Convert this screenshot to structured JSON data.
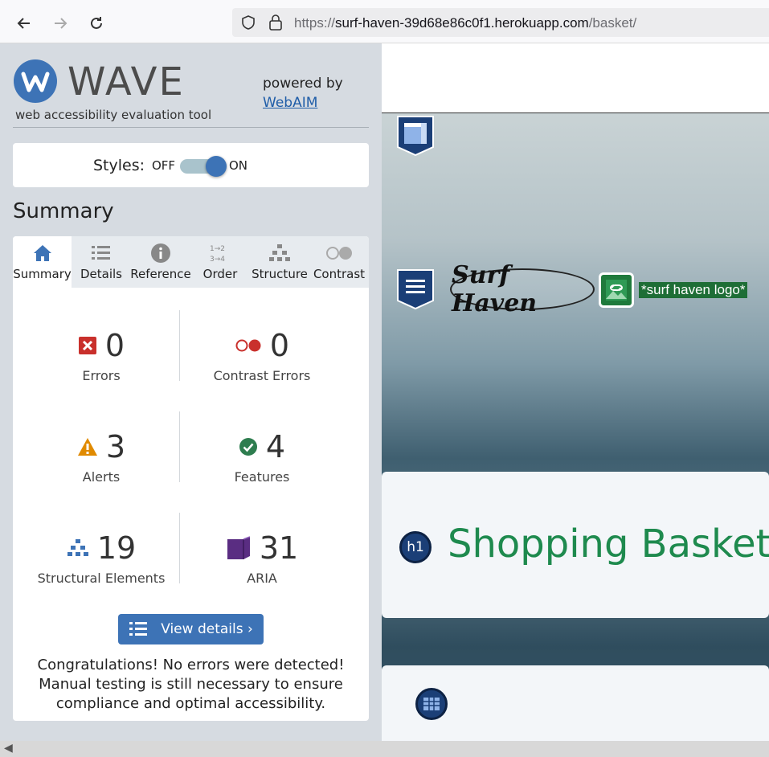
{
  "browser": {
    "url_prefix": "https://",
    "url_host": "surf-haven-39d68e86c0f1.herokuapp.com",
    "url_path": "/basket/"
  },
  "wave": {
    "title": "WAVE",
    "subtitle": "web accessibility evaluation tool",
    "powered_by": "powered by",
    "webaim_link": "WebAIM",
    "styles_label": "Styles:",
    "styles_off": "OFF",
    "styles_on": "ON",
    "styles_state": "on",
    "summary_heading": "Summary",
    "tabs": [
      {
        "label": "Summary",
        "icon": "home-icon",
        "active": true
      },
      {
        "label": "Details",
        "icon": "list-icon",
        "active": false
      },
      {
        "label": "Reference",
        "icon": "info-icon",
        "active": false
      },
      {
        "label": "Order",
        "icon": "order-icon",
        "active": false
      },
      {
        "label": "Structure",
        "icon": "structure-icon",
        "active": false
      },
      {
        "label": "Contrast",
        "icon": "contrast-icon",
        "active": false
      }
    ],
    "stats": {
      "errors": {
        "value": "0",
        "label": "Errors"
      },
      "contrast_errors": {
        "value": "0",
        "label": "Contrast Errors"
      },
      "alerts": {
        "value": "3",
        "label": "Alerts"
      },
      "features": {
        "value": "4",
        "label": "Features"
      },
      "structural": {
        "value": "19",
        "label": "Structural Elements"
      },
      "aria": {
        "value": "31",
        "label": "ARIA"
      }
    },
    "view_details": "View details ›",
    "congrats": "Congratulations! No errors were detected! Manual testing is still necessary to ensure compliance and optimal accessibility.",
    "colors": {
      "accent": "#3d73b6",
      "error": "#c0392b",
      "alert": "#e08a00",
      "feature": "#2e7d4f",
      "aria": "#5a2d82"
    }
  },
  "page": {
    "logo_text": "Surf Haven",
    "logo_alt": "*surf haven logo*",
    "heading_badge": "h1",
    "heading": "Shopping Basket",
    "heading_color": "#1e8a4e"
  }
}
